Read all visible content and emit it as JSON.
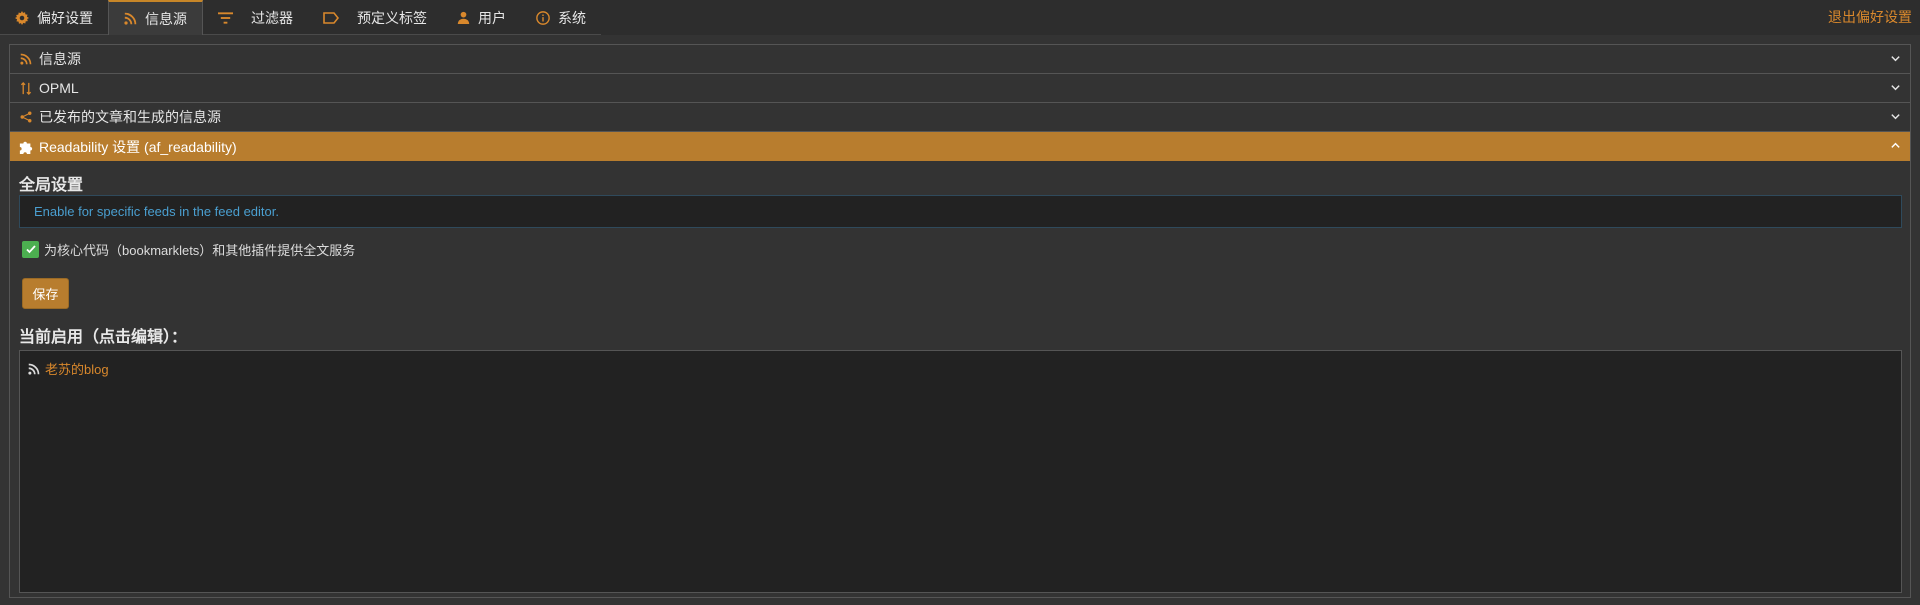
{
  "colors": {
    "accent": "#b87d2e",
    "link": "#d9882c",
    "notice_text": "#4a9fd0",
    "checkbox": "#4caf50",
    "background": "#333333",
    "panel": "#222222"
  },
  "tabs": [
    {
      "label": "偏好设置",
      "icon": "gear-icon"
    },
    {
      "label": "信息源",
      "icon": "rss-icon",
      "active": true
    },
    {
      "label": "过滤器",
      "icon": "filter-icon"
    },
    {
      "label": "预定义标签",
      "icon": "label-icon"
    },
    {
      "label": "用户",
      "icon": "user-icon"
    },
    {
      "label": "系统",
      "icon": "info-icon"
    }
  ],
  "exit_label": "退出偏好设置",
  "accordion": {
    "sections": [
      {
        "label": "信息源",
        "icon": "rss-icon"
      },
      {
        "label": "OPML",
        "icon": "sort-arrows-icon"
      },
      {
        "label": "已发布的文章和生成的信息源",
        "icon": "share-icon"
      },
      {
        "label": "Readability 设置 (af_readability)",
        "icon": "puzzle-icon",
        "expanded": true
      }
    ]
  },
  "readability": {
    "global_title": "全局设置",
    "notice": "Enable for specific feeds in the feed editor.",
    "checkbox_label": "为核心代码（bookmarklets）和其他插件提供全文服务",
    "checkbox_checked": true,
    "save_label": "保存",
    "enabled_title": "当前启用（点击编辑）：",
    "feeds": [
      {
        "title": "老苏的blog",
        "icon": "rss-icon"
      }
    ]
  }
}
